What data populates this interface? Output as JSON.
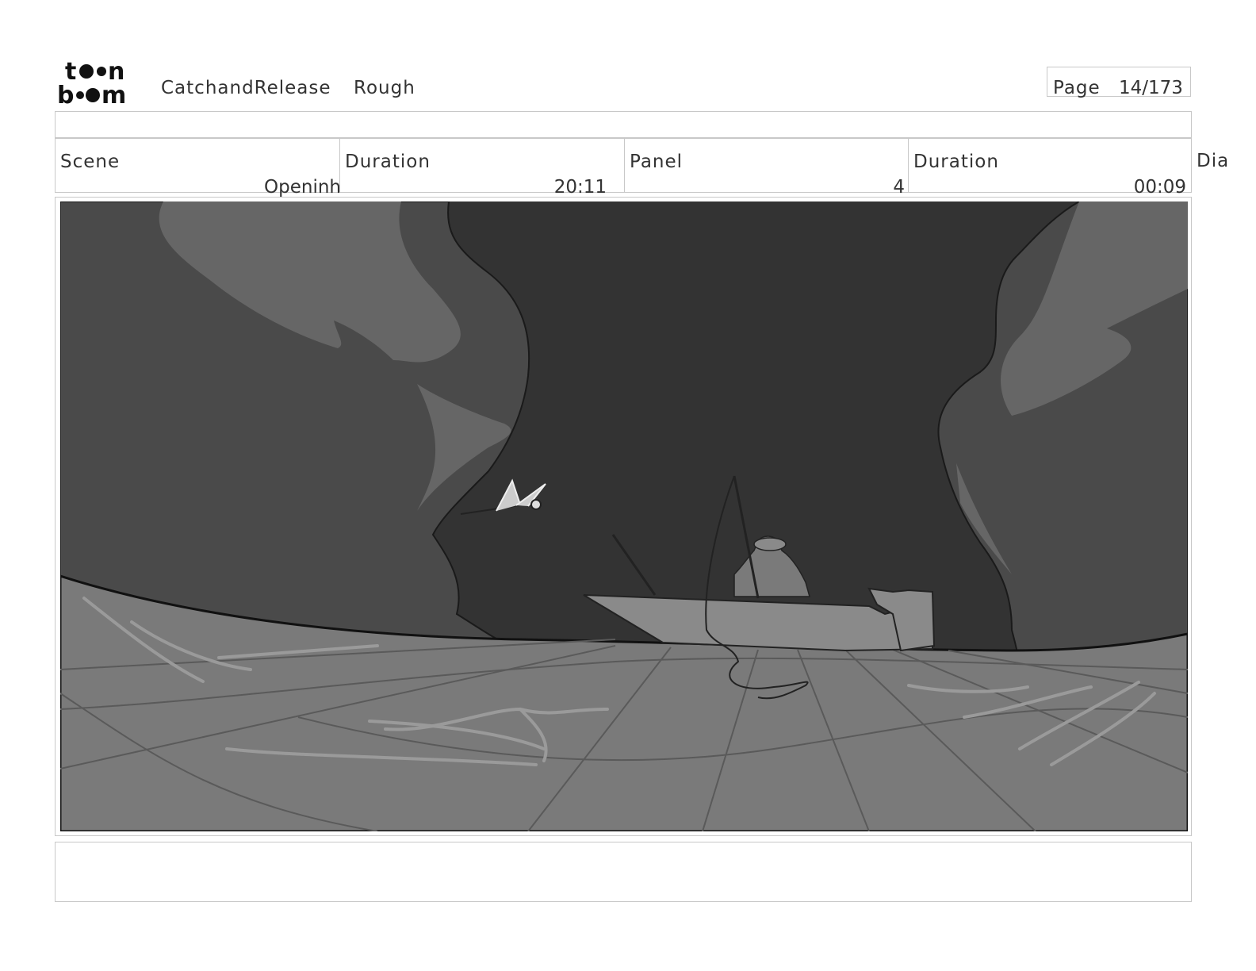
{
  "header": {
    "logo_text_top": "toon",
    "logo_text_bottom": "boom",
    "project": "CatchandRelease",
    "stage": "Rough",
    "page_label": "Page",
    "page_value": "14/173"
  },
  "info": {
    "scene_label": "Scene",
    "scene_value": "Openinh",
    "scene_duration_label": "Duration",
    "scene_duration_value": "20:11",
    "panel_label": "Panel",
    "panel_value": "4",
    "panel_duration_label": "Duration",
    "panel_duration_value": "00:09",
    "dialogue_label": "Dia"
  },
  "notes": {
    "text": ""
  }
}
